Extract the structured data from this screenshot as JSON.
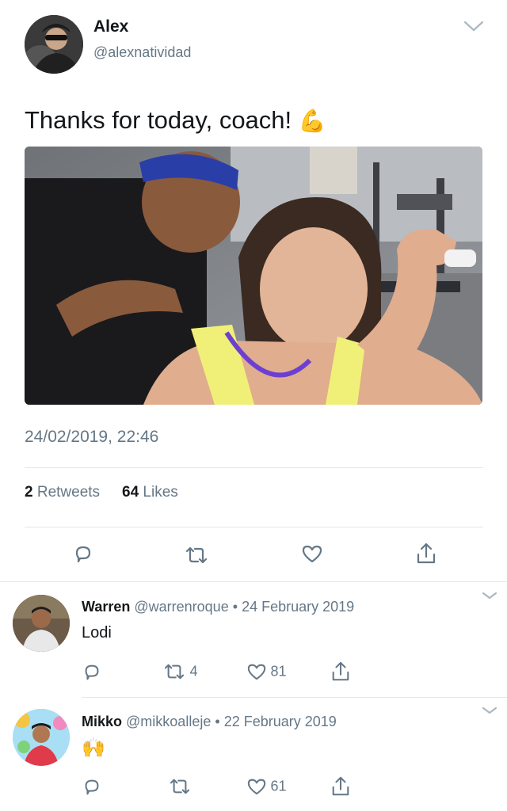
{
  "tweet": {
    "author_name": "Alex",
    "author_handle": "@alexnatividad",
    "text": "Thanks for today, coach! ",
    "text_emoji": "💪",
    "timestamp": "24/02/2019, 22:46",
    "retweets_count": "2",
    "retweets_label": "Retweets",
    "likes_count": "64",
    "likes_label": "Likes"
  },
  "replies": [
    {
      "name": "Warren",
      "handle": "@warrenroque",
      "dot": "•",
      "date": "24 February 2019",
      "text": "Lodi",
      "retweet_count": "4",
      "like_count": "81"
    },
    {
      "name": "Mikko",
      "handle": "@mikkoalleje",
      "dot": "•",
      "date": "22 February 2019",
      "text": "🙌",
      "retweet_count": "",
      "like_count": "61"
    }
  ],
  "icons": {
    "reply": "reply-icon",
    "retweet": "retweet-icon",
    "like": "heart-icon",
    "share": "share-icon",
    "chevron": "chevron-down-icon"
  },
  "colors": {
    "text": "#14171a",
    "muted": "#657786",
    "divider": "#e1e8ed"
  }
}
